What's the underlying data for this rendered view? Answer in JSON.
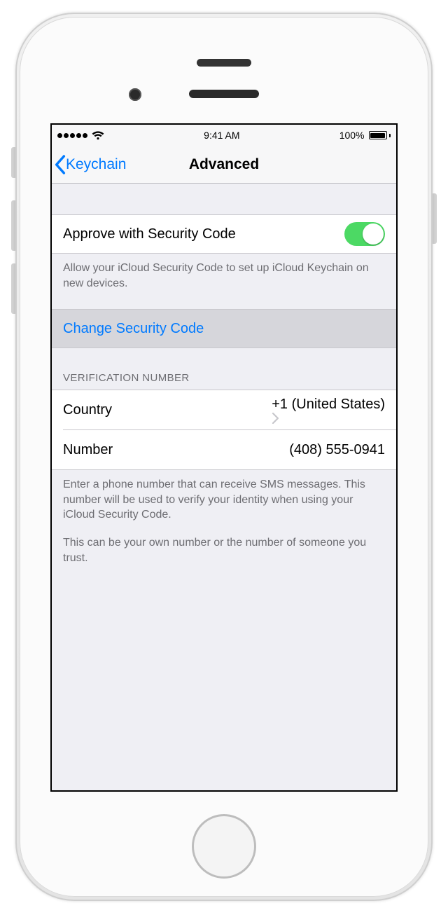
{
  "status": {
    "time": "9:41 AM",
    "battery": "100%"
  },
  "nav": {
    "back_label": "Keychain",
    "title": "Advanced"
  },
  "approve": {
    "label": "Approve with Security Code",
    "on": true,
    "footnote": "Allow your iCloud Security Code to set up iCloud Keychain on new devices."
  },
  "change": {
    "label": "Change Security Code"
  },
  "verification": {
    "header": "VERIFICATION NUMBER",
    "country_label": "Country",
    "country_value": "+1 (United States)",
    "number_label": "Number",
    "number_value": "(408) 555-0941",
    "footnote1": "Enter a phone number that can receive SMS messages. This number will be used to verify your identity when using your iCloud Security Code.",
    "footnote2": "This can be your own number or the number of someone you trust."
  }
}
